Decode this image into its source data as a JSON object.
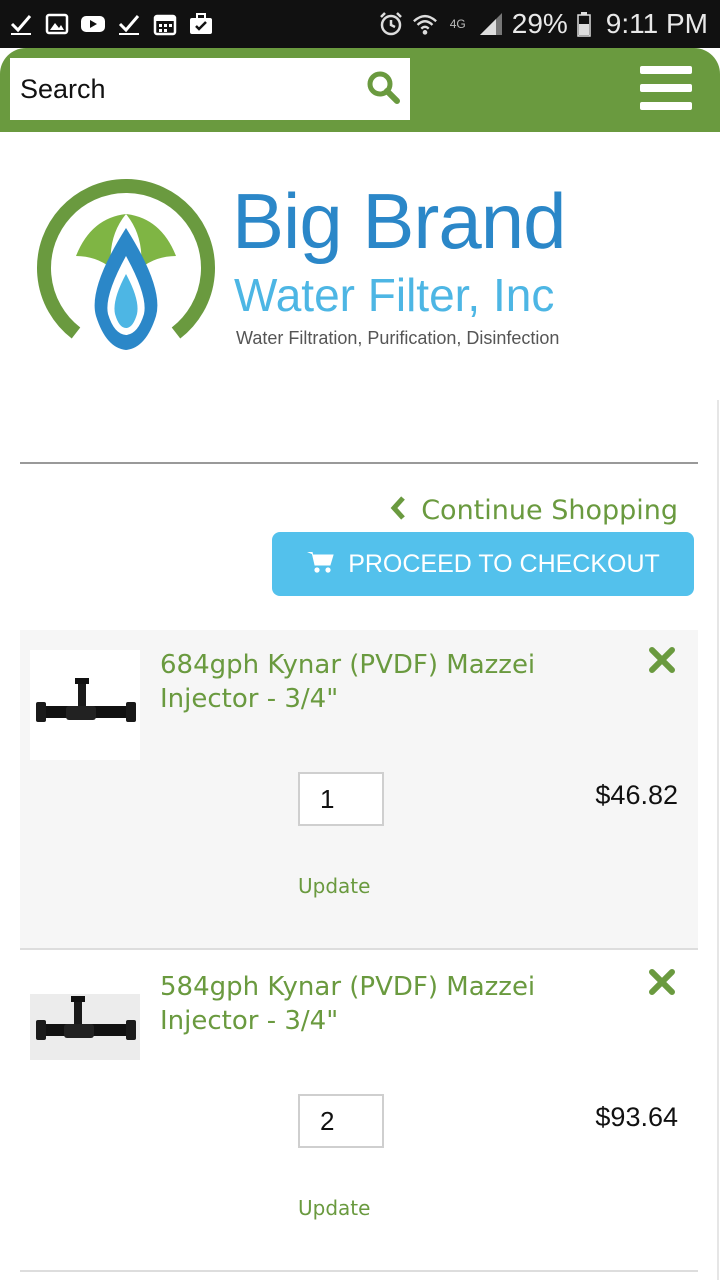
{
  "status_bar": {
    "left_icons": [
      "check-icon",
      "image-icon",
      "youtube-icon",
      "check-icon",
      "calendar-icon",
      "briefcase-check-icon"
    ],
    "right_icons": [
      "alarm-icon",
      "wifi-icon",
      "lte-icon",
      "signal-icon",
      "battery-icon"
    ],
    "network": "4G",
    "battery": "29%",
    "time": "9:11 PM"
  },
  "header": {
    "search_placeholder": "Search",
    "search_icon": "search-icon",
    "menu_icon": "hamburger-menu-icon",
    "color": "#6a9a3f"
  },
  "logo": {
    "title": "Big Brand",
    "subtitle": "Water Filter, Inc",
    "tagline": "Water Filtration, Purification, Disinfection"
  },
  "cart": {
    "continue_label": "Continue Shopping",
    "checkout_label": "PROCEED TO CHECKOUT",
    "checkout_color": "#53c1ec",
    "items": [
      {
        "title": "684gph Kynar (PVDF) Mazzei Injector - 3/4\"",
        "quantity": "1",
        "price": "$46.82",
        "update_label": "Update"
      },
      {
        "title": "584gph Kynar (PVDF) Mazzei Injector - 3/4\"",
        "quantity": "2",
        "price": "$93.64",
        "update_label": "Update"
      }
    ]
  }
}
